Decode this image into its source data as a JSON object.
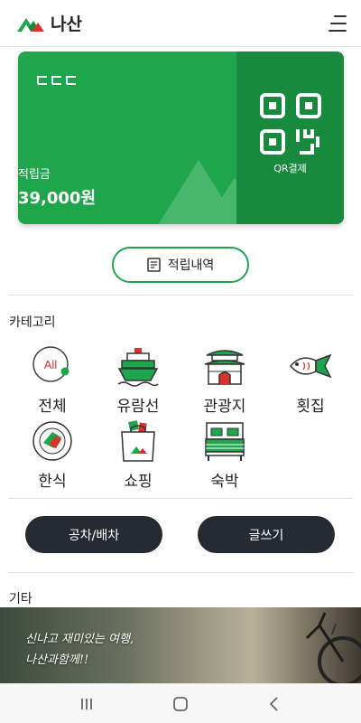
{
  "app": {
    "title": "나산",
    "brand_color": "#1fa64d",
    "brand_dark": "#178a3e",
    "logo_icon": "mountain-logo-icon"
  },
  "header": {
    "menu_icon": "hamburger-menu-icon"
  },
  "card": {
    "brand_mark": "CCC",
    "label": "적립금",
    "balance": "39,000원",
    "qr_icon": "qr-code-icon",
    "qr_label": "QR결제"
  },
  "history_button": {
    "label": "적립내역",
    "icon": "document-icon"
  },
  "categories": {
    "title": "카테고리",
    "items": [
      {
        "label": "전체",
        "icon": "all-icon",
        "badge": "All"
      },
      {
        "label": "유람선",
        "icon": "cruise-ship-icon"
      },
      {
        "label": "관광지",
        "icon": "palace-gate-icon"
      },
      {
        "label": "횟집",
        "icon": "fish-icon"
      },
      {
        "label": "한식",
        "icon": "korean-food-icon"
      },
      {
        "label": "쇼핑",
        "icon": "shopping-bag-icon"
      },
      {
        "label": "숙박",
        "icon": "bed-icon"
      }
    ]
  },
  "actions": {
    "left_label": "공차/배차",
    "right_label": "글쓰기",
    "button_color": "#262b33"
  },
  "other": {
    "title": "기타",
    "banner_line1": "신나고 재미있는 여행,",
    "banner_line2": "나산과함께!!"
  },
  "navbar": {
    "recent_icon": "recent-apps-icon",
    "home_icon": "home-icon",
    "back_icon": "back-icon"
  }
}
